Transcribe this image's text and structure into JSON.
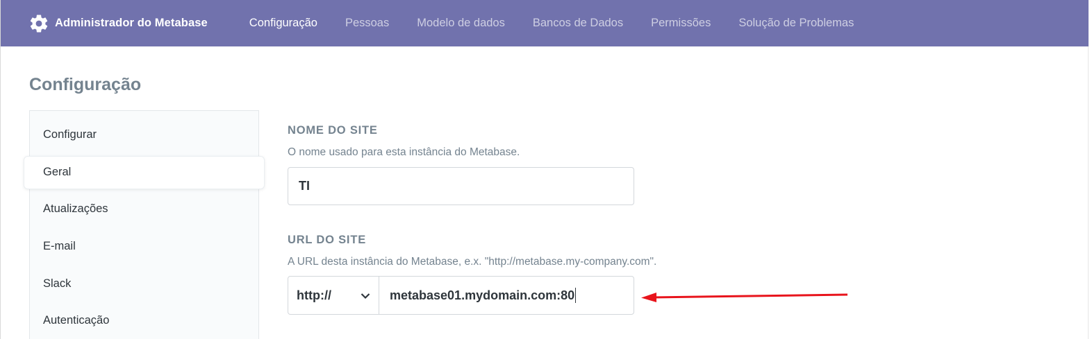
{
  "header": {
    "brand_title": "Administrador do Metabase",
    "brand_icon": "gear-icon",
    "nav": [
      "Configuração",
      "Pessoas",
      "Modelo de dados",
      "Bancos de Dados",
      "Permissões",
      "Solução de Problemas"
    ],
    "active_nav": "Configuração",
    "bg_color": "#7172ad"
  },
  "page_title": "Configuração",
  "sidebar": {
    "items": [
      {
        "label": "Configurar"
      },
      {
        "label": "Geral"
      },
      {
        "label": "Atualizações"
      },
      {
        "label": "E-mail"
      },
      {
        "label": "Slack"
      },
      {
        "label": "Autenticação"
      }
    ],
    "active": "Geral"
  },
  "settings": {
    "site_name": {
      "heading": "NOME DO SITE",
      "description": "O nome usado para esta instância do Metabase.",
      "value": "TI"
    },
    "site_url": {
      "heading": "URL DO SITE",
      "description": "A URL desta instância do Metabase, e.x. \"http://metabase.my-company.com\".",
      "protocol": "http://",
      "value": "metabase01.mydomain.com:80"
    }
  },
  "annotation": {
    "arrow_color": "#e8141c"
  }
}
